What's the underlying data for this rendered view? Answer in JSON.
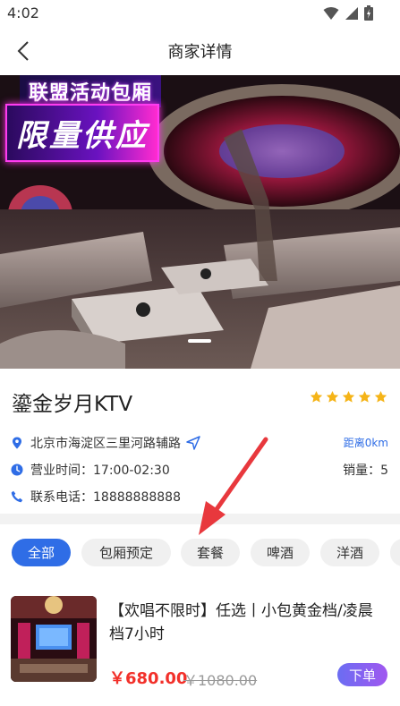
{
  "status_bar": {
    "time": "4:02"
  },
  "nav": {
    "title": "商家详情"
  },
  "banner": {
    "tag_line1": "联盟活动包厢",
    "tag_line2": "限量供应"
  },
  "shop": {
    "name": "鎏金岁月KTV",
    "rating_stars": 5,
    "address": "北京市海淀区三里河路辅路",
    "distance": "距离0km",
    "hours": "营业时间：17:00-02:30",
    "sales": "销量：5",
    "phone": "联系电话：18888888888"
  },
  "tabs": [
    {
      "label": "全部",
      "active": true
    },
    {
      "label": "包厢预定",
      "active": false
    },
    {
      "label": "套餐",
      "active": false
    },
    {
      "label": "啤酒",
      "active": false
    },
    {
      "label": "洋酒",
      "active": false
    }
  ],
  "product": {
    "title": "【欢唱不限时】任选丨小包黄金档/凌晨档7小时",
    "price": "￥680.00",
    "original_price": "￥1080.00",
    "order_label": "下单"
  },
  "colors": {
    "accent": "#2f6de6",
    "price": "#f2302a",
    "star": "#f5b418",
    "annotation_arrow": "#e8383d"
  },
  "icons": [
    "back-icon",
    "wifi-icon",
    "signal-icon",
    "battery-icon",
    "location-icon",
    "navigate-icon",
    "clock-icon",
    "phone-icon",
    "star-icon"
  ]
}
